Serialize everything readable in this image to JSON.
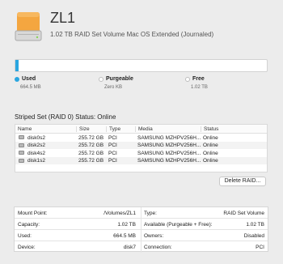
{
  "header": {
    "icon": "disk-icon",
    "volume_name": "ZL1",
    "description": "1.02 TB RAID Set Volume Mac OS Extended (Journaled)"
  },
  "usage": {
    "used_fraction": 0.00065,
    "legend": [
      {
        "label": "Used",
        "value": "664.5 MB",
        "color": "#2aa6e0"
      },
      {
        "label": "Purgeable",
        "value": "Zero KB",
        "color": "#ffffff"
      },
      {
        "label": "Free",
        "value": "1.02 TB",
        "color": "#ffffff"
      }
    ]
  },
  "raid": {
    "title": "Striped Set (RAID 0) Status: Online",
    "columns": [
      "Name",
      "Size",
      "Type",
      "Media",
      "Status"
    ],
    "rows": [
      {
        "name": "disk0s2",
        "size": "255.72 GB",
        "type": "PCI",
        "media": "SAMSUNG MZHPV256H...",
        "status": "Online"
      },
      {
        "name": "disk2s2",
        "size": "255.72 GB",
        "type": "PCI",
        "media": "SAMSUNG MZHPV256H...",
        "status": "Online"
      },
      {
        "name": "disk4s2",
        "size": "255.72 GB",
        "type": "PCI",
        "media": "SAMSUNG MZHPV256H...",
        "status": "Online"
      },
      {
        "name": "disk1s2",
        "size": "255.72 GB",
        "type": "PCI",
        "media": "SAMSUNG MZHPV256H...",
        "status": "Online"
      }
    ],
    "delete_label": "Delete RAID..."
  },
  "info": {
    "left": [
      {
        "label": "Mount Point:",
        "value": "/Volumes/ZL1"
      },
      {
        "label": "Capacity:",
        "value": "1.02 TB"
      },
      {
        "label": "Used:",
        "value": "664.5 MB"
      },
      {
        "label": "Device:",
        "value": "disk7"
      }
    ],
    "right": [
      {
        "label": "Type:",
        "value": "RAID Set Volume"
      },
      {
        "label": "Available (Purgeable + Free):",
        "value": "1.02 TB"
      },
      {
        "label": "Owners:",
        "value": "Disabled"
      },
      {
        "label": "Connection:",
        "value": "PCI"
      }
    ]
  }
}
